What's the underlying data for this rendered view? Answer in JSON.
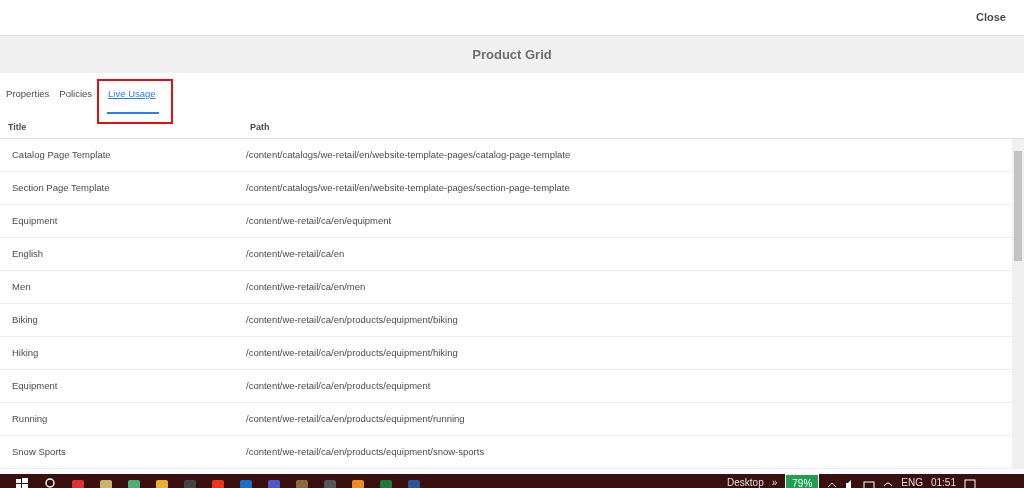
{
  "header": {
    "close": "Close"
  },
  "dialog": {
    "title": "Product Grid"
  },
  "tabs": [
    {
      "label": "Properties",
      "selected": false
    },
    {
      "label": "Policies",
      "selected": false
    },
    {
      "label": "Live Usage",
      "selected": true
    }
  ],
  "table": {
    "columns": [
      "Title",
      "Path"
    ],
    "rows": [
      [
        "Catalog Page Template",
        "/content/catalogs/we-retail/en/website-template-pages/catalog-page-template"
      ],
      [
        "Section Page Template",
        "/content/catalogs/we-retail/en/website-template-pages/section-page-template"
      ],
      [
        "Equipment",
        "/content/we-retail/ca/en/equipment"
      ],
      [
        "English",
        "/content/we-retail/ca/en"
      ],
      [
        "Men",
        "/content/we-retail/ca/en/men"
      ],
      [
        "Biking",
        "/content/we-retail/ca/en/products/equipment/biking"
      ],
      [
        "Hiking",
        "/content/we-retail/ca/en/products/equipment/hiking"
      ],
      [
        "Equipment",
        "/content/we-retail/ca/en/products/equipment"
      ],
      [
        "Running",
        "/content/we-retail/ca/en/products/equipment/running"
      ],
      [
        "Snow Sports",
        "/content/we-retail/ca/en/products/equipment/snow-sports"
      ]
    ]
  },
  "taskbar": {
    "desktop": "Desktop",
    "chevron": "»",
    "battery": "79%",
    "language": "ENG",
    "time": "01:51"
  }
}
